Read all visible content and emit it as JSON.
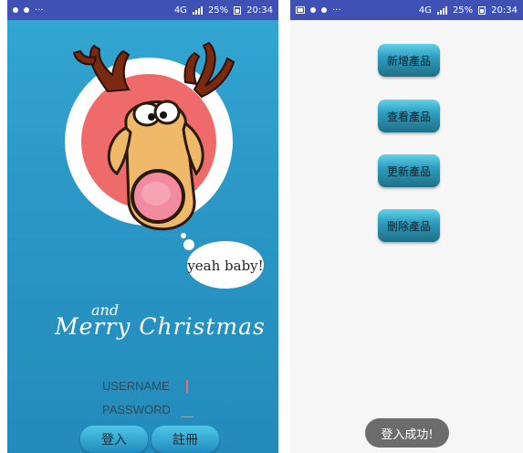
{
  "left": {
    "status": {
      "network": "4G",
      "battery": "25%",
      "time": "20:34"
    },
    "art": {
      "speech": "yeah baby!"
    },
    "greeting": {
      "small": "and",
      "title": "Merry Christmas"
    },
    "form": {
      "username_label": "USERNAME",
      "password_label": "PASSWORD"
    },
    "buttons": {
      "login": "登入",
      "register": "註冊"
    },
    "colors": {
      "bg_top": "#33a7d3",
      "bg_bottom": "#238bbb",
      "status": "#3f51b5"
    }
  },
  "right": {
    "status": {
      "network": "4G",
      "battery": "25%",
      "time": "20:34"
    },
    "menu": [
      "新增產品",
      "查看產品",
      "更新產品",
      "刪除產品"
    ],
    "toast": "登入成功!",
    "colors": {
      "button_top": "#62d1e8",
      "button_bottom": "#1f6f86",
      "toast": "#6c6c6c"
    }
  }
}
